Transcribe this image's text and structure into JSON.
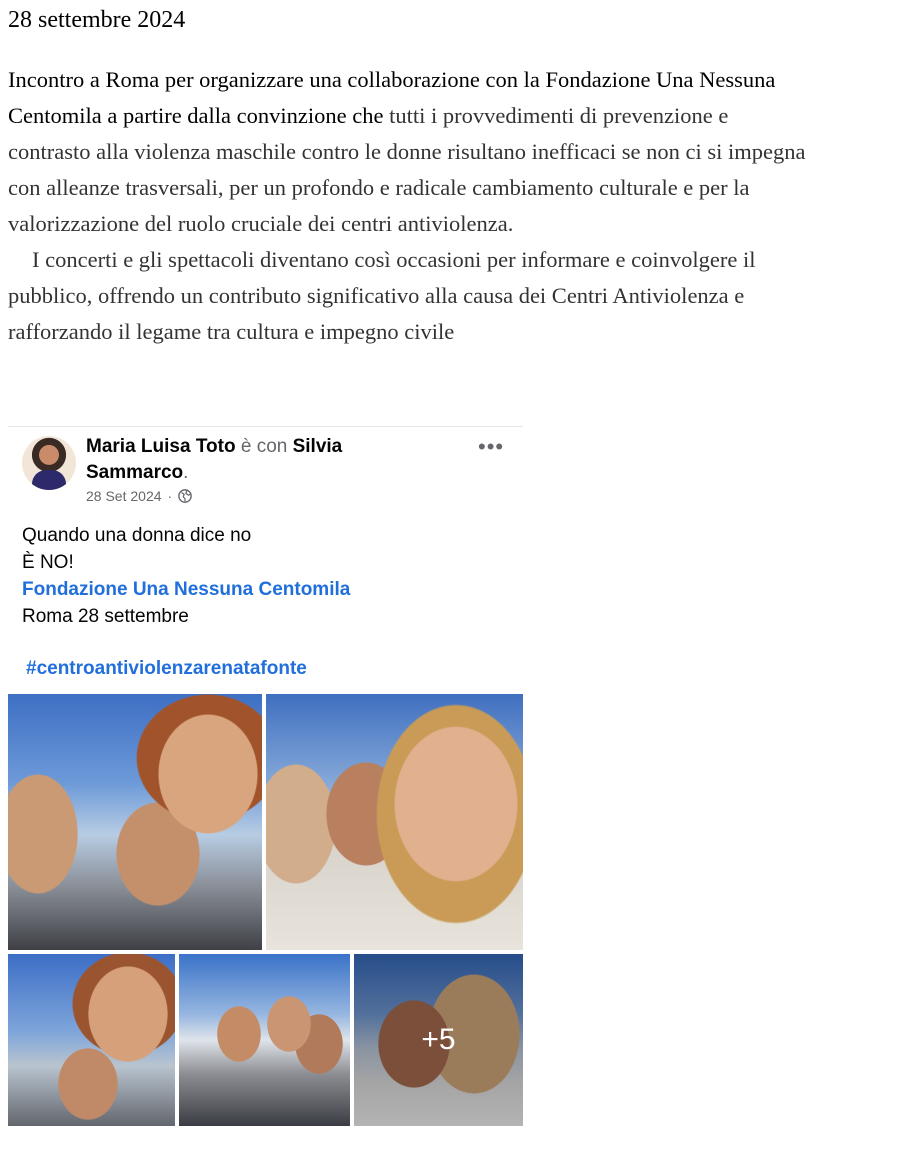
{
  "document": {
    "date": "28 settembre 2024",
    "paragraph_lines": [
      "Incontro a Roma per organizzare una collaborazione con la Fondazione Una Nessuna",
      "Centomila a partire dalla convinzione che tutti i provvedimenti di prevenzione e",
      "contrasto alla violenza maschile contro le donne risultano inefficaci se non ci si impegna",
      "con alleanze trasversali, per un profondo e radicale cambiamento culturale e per la",
      "valorizzazione del ruolo cruciale dei centri antiviolenza.",
      "I concerti e gli spettacoli diventano così occasioni per informare e coinvolgere il",
      "pubblico, offrendo un contributo significativo alla causa dei Centri Antiviolenza e",
      "rafforzando il legame tra cultura e impegno civile"
    ],
    "line2_strong": "Centomila a partire dalla convinzione che",
    "line2_rest": " tutti i provvedimenti di prevenzione e"
  },
  "post": {
    "author": "Maria Luisa Toto",
    "with_word": "è con",
    "tagged_first": "Silvia",
    "tagged_second": "Sammarco",
    "period": ".",
    "timestamp": "28 Set 2024",
    "separator": "·",
    "privacy_icon": "globe-icon",
    "more_label": "•••",
    "text_line1": "Quando una donna dice no",
    "text_line2": "È NO!",
    "link_text": "Fondazione Una Nessuna Centomila",
    "text_line4": "Roma 28 settembre",
    "hashtag": "#centroantiviolenzarenatafonte",
    "more_photos": "+5",
    "link_color": "#216fdb"
  }
}
